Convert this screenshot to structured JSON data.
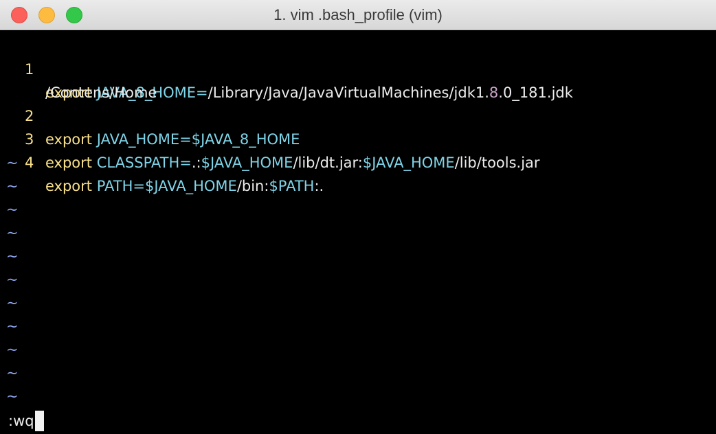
{
  "window": {
    "title": "1. vim .bash_profile (vim)"
  },
  "lines": [
    {
      "number": "1",
      "keyword": "export",
      "name": "JAVA_8_HOME=",
      "value_part1": "/Library/Java/JavaVirtualMachines/jdk1.",
      "value_highlight": "8",
      "value_part2": ".0_181.jdk",
      "wrap": "/Contens/Home"
    },
    {
      "number": "2",
      "keyword": "export",
      "name": "JAVA_HOME=",
      "ref": "$JAVA_8_HOME"
    },
    {
      "number": "3",
      "keyword": "export",
      "name": "CLASSPATH=",
      "seg1": ".:",
      "ref1": "$JAVA_HOME",
      "seg2": "/lib/dt.jar:",
      "ref2": "$JAVA_HOME",
      "seg3": "/lib/tools.jar"
    },
    {
      "number": "4",
      "keyword": "export",
      "name": "PATH=",
      "ref1": "$JAVA_HOME",
      "seg1": "/bin:",
      "ref2": "$PATH",
      "seg2": ":."
    }
  ],
  "empty_line_marker": "~",
  "command_line": ":wq",
  "colors": {
    "keyword": "#f8e08a",
    "variable": "#7fd4e8",
    "text": "#ececec",
    "tilde": "#8fa7f0",
    "background": "#000000"
  }
}
